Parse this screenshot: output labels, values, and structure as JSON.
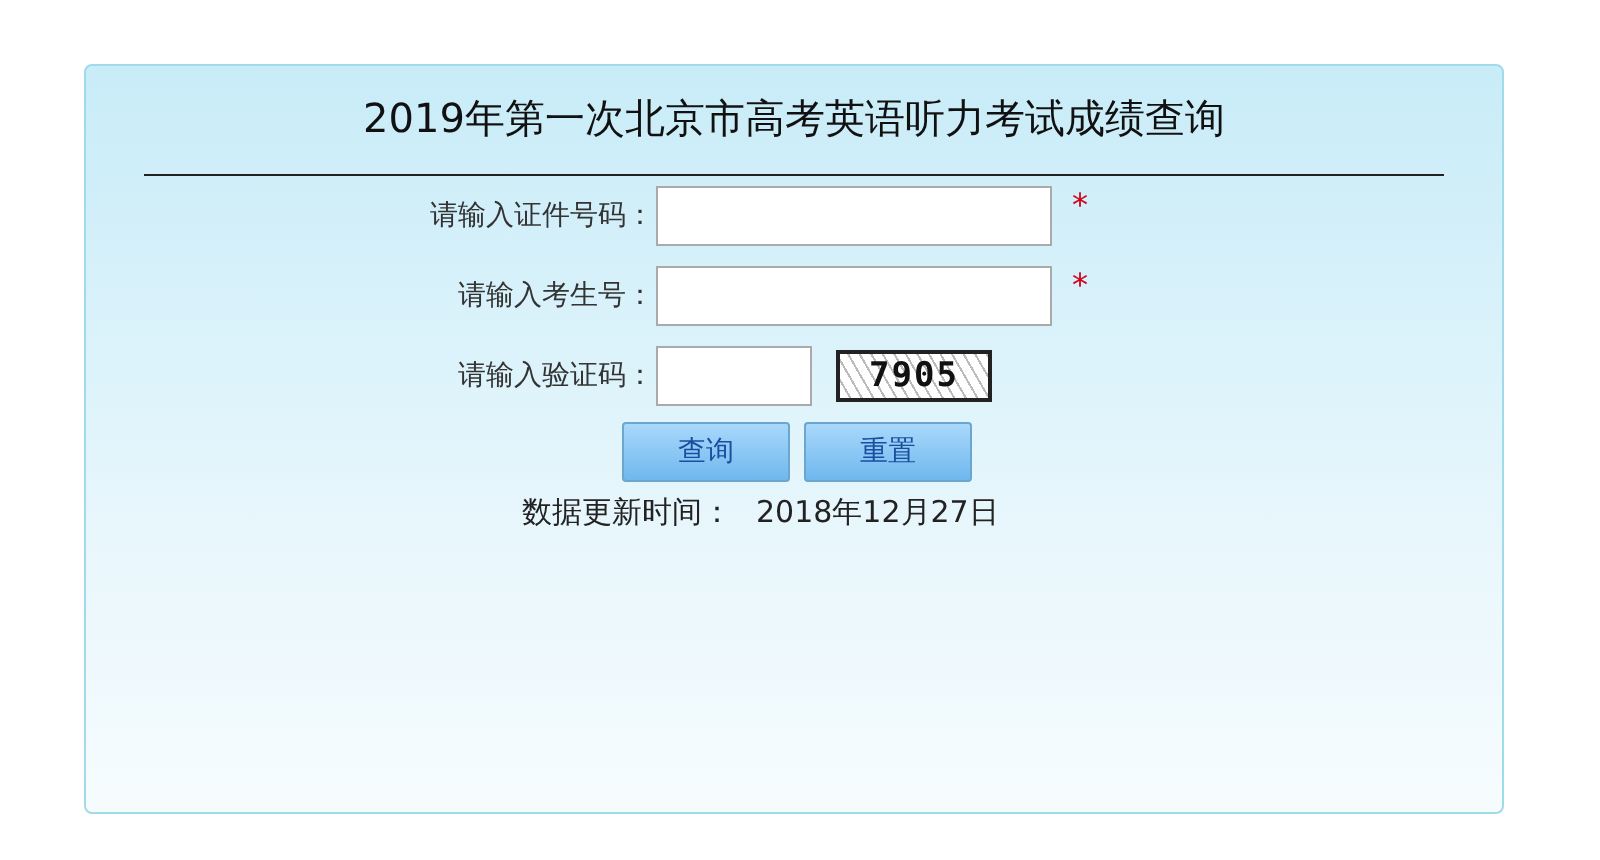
{
  "title": "2019年第一次北京市高考英语听力考试成绩查询",
  "fields": [
    {
      "label": "请输入证件号码：",
      "kind": "text",
      "mark": "*"
    },
    {
      "label": "请输入考生号：",
      "kind": "text",
      "mark": "*"
    },
    {
      "label": "请输入验证码：",
      "kind": "captcha",
      "captcha": "7905"
    }
  ],
  "buttons": [
    "查询",
    "重置"
  ],
  "update_label": "数据更新时间：",
  "update_date": "2018年12月27日"
}
